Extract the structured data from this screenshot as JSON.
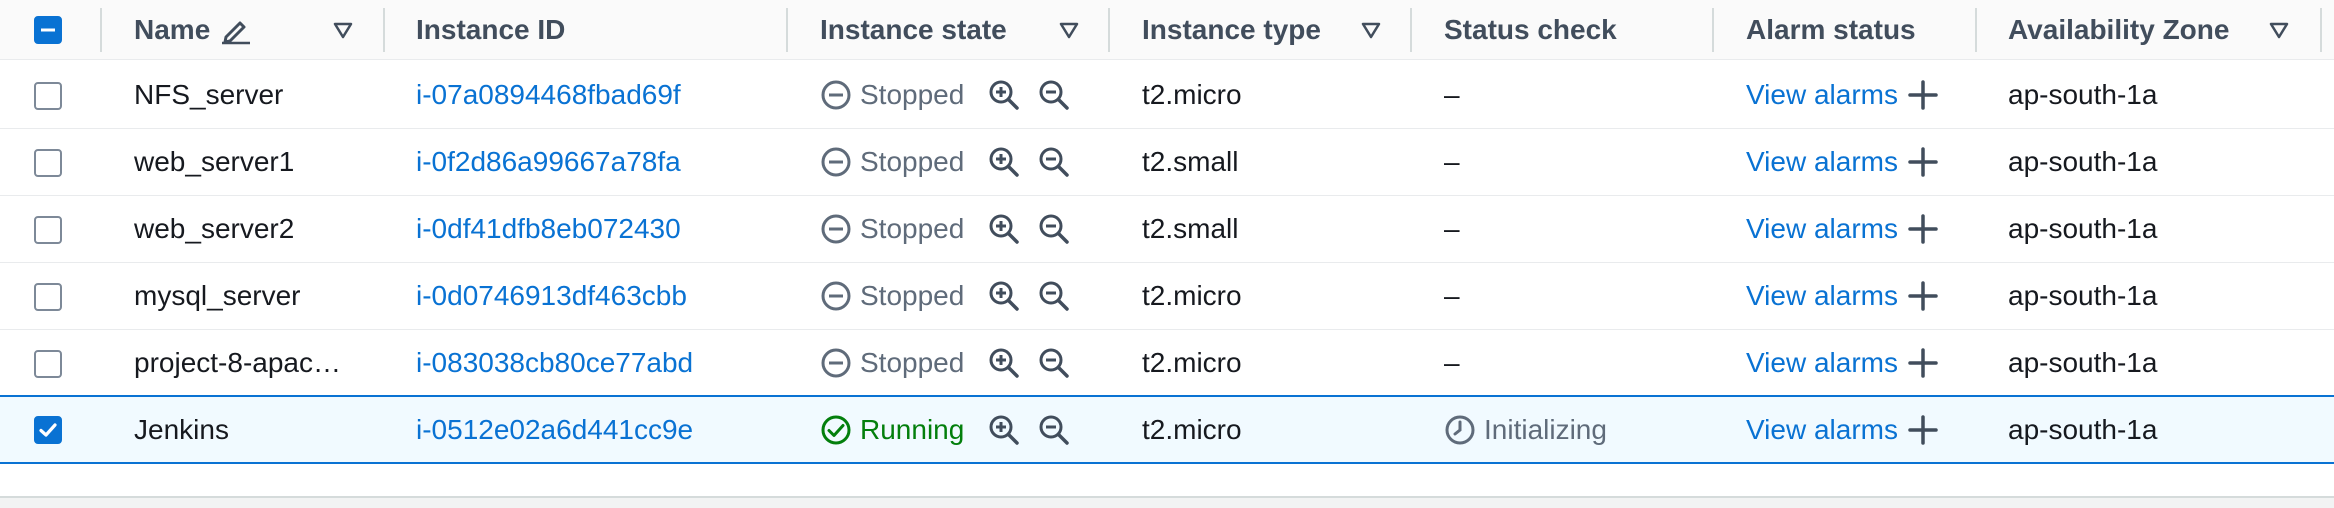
{
  "columns": {
    "name": "Name",
    "instance_id": "Instance ID",
    "instance_state": "Instance state",
    "instance_type": "Instance type",
    "status_check": "Status check",
    "alarm_status": "Alarm status",
    "availability_zone": "Availability Zone"
  },
  "rows": [
    {
      "name": "NFS_server",
      "instance_id": "i-07a0894468fbad69f",
      "state": "Stopped",
      "type": "t2.micro",
      "status_check": "–",
      "alarm": "View alarms",
      "az": "ap-south-1a",
      "selected": false
    },
    {
      "name": "web_server1",
      "instance_id": "i-0f2d86a99667a78fa",
      "state": "Stopped",
      "type": "t2.small",
      "status_check": "–",
      "alarm": "View alarms",
      "az": "ap-south-1a",
      "selected": false
    },
    {
      "name": "web_server2",
      "instance_id": "i-0df41dfb8eb072430",
      "state": "Stopped",
      "type": "t2.small",
      "status_check": "–",
      "alarm": "View alarms",
      "az": "ap-south-1a",
      "selected": false
    },
    {
      "name": "mysql_server",
      "instance_id": "i-0d0746913df463cbb",
      "state": "Stopped",
      "type": "t2.micro",
      "status_check": "–",
      "alarm": "View alarms",
      "az": "ap-south-1a",
      "selected": false
    },
    {
      "name": "project-8-apac…",
      "instance_id": "i-083038cb80ce77abd",
      "state": "Stopped",
      "type": "t2.micro",
      "status_check": "–",
      "alarm": "View alarms",
      "az": "ap-south-1a",
      "selected": false
    },
    {
      "name": "Jenkins",
      "instance_id": "i-0512e02a6d441cc9e",
      "state": "Running",
      "type": "t2.micro",
      "status_check": "Initializing",
      "alarm": "View alarms",
      "az": "ap-south-1a",
      "selected": true
    }
  ],
  "colors": {
    "link": "#0972d3",
    "running": "#037f0c",
    "stopped": "#5f6b7a",
    "selected_row_bg": "#f1faff"
  },
  "icons": {
    "name_header": "pencil-icon",
    "sort": "caret-down-icon",
    "stopped": "minus-circle-icon",
    "running": "check-circle-icon",
    "zoom_in": "zoom-in-icon",
    "zoom_out": "zoom-out-icon",
    "initializing": "clock-icon",
    "add_alarm": "plus-icon"
  }
}
